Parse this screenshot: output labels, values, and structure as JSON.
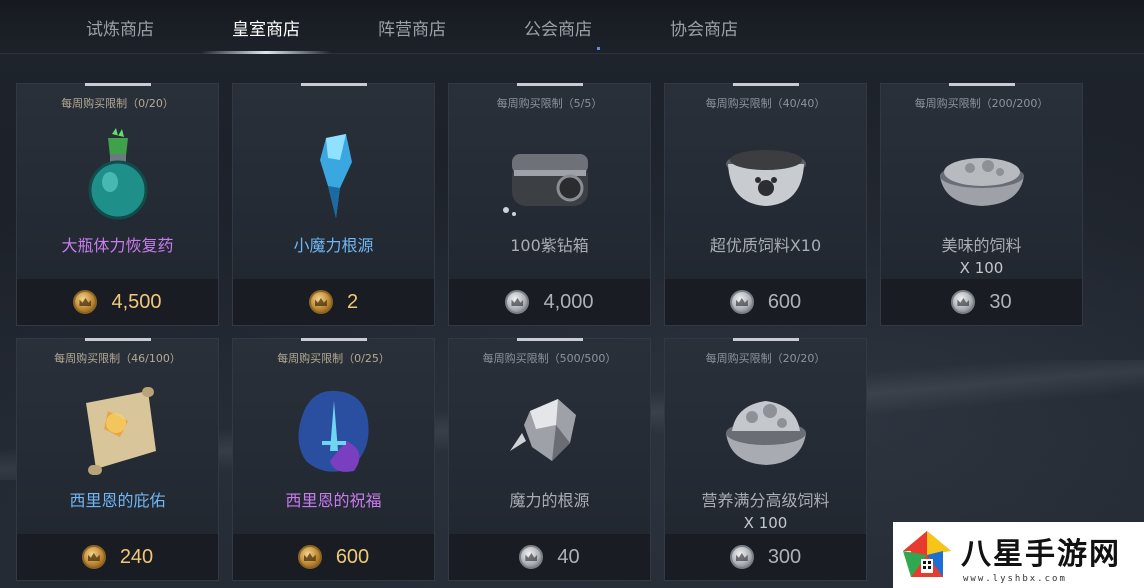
{
  "tabs": [
    {
      "label": "试炼商店",
      "active": false
    },
    {
      "label": "皇室商店",
      "active": true
    },
    {
      "label": "阵营商店",
      "active": false
    },
    {
      "label": "公会商店",
      "active": false
    },
    {
      "label": "协会商店",
      "active": false
    }
  ],
  "items": [
    {
      "limit": "每周购买限制（0/20）",
      "name": "大瓶体力恢复药",
      "qty": "",
      "price": "4,500",
      "currency": "gold",
      "name_color": "#c97cf0",
      "icon": "potion-icon"
    },
    {
      "limit": "",
      "name": "小魔力根源",
      "qty": "",
      "price": "2",
      "currency": "gold",
      "name_color": "#6fb7f5",
      "icon": "crystal-icon"
    },
    {
      "limit": "每周购买限制（5/5）",
      "name": "100紫钻箱",
      "qty": "",
      "price": "4,000",
      "currency": "silver",
      "name_color": "#a9adb3",
      "icon": "chest-icon"
    },
    {
      "limit": "每周购买限制（40/40）",
      "name": "超优质饲料X10",
      "qty": "",
      "price": "600",
      "currency": "silver",
      "name_color": "#a9adb3",
      "icon": "pet-bowl-icon"
    },
    {
      "limit": "每周购买限制（200/200）",
      "name": "美味的饲料",
      "qty": "X 100",
      "price": "30",
      "currency": "silver",
      "name_color": "#a9adb3",
      "icon": "food-bowl-icon"
    },
    {
      "limit": "每周购买限制（46/100）",
      "name": "西里恩的庇佑",
      "qty": "",
      "price": "240",
      "currency": "gold",
      "name_color": "#6fb7f5",
      "icon": "scroll-icon"
    },
    {
      "limit": "每周购买限制（0/25）",
      "name": "西里恩的祝福",
      "qty": "",
      "price": "600",
      "currency": "gold",
      "name_color": "#c97cf0",
      "icon": "rune-stone-icon"
    },
    {
      "limit": "每周购买限制（500/500）",
      "name": "魔力的根源",
      "qty": "",
      "price": "40",
      "currency": "silver",
      "name_color": "#a9adb3",
      "icon": "mana-crystal-icon"
    },
    {
      "limit": "每周购买限制（20/20）",
      "name": "营养满分高级饲料",
      "qty": "X 100",
      "price": "300",
      "currency": "silver",
      "name_color": "#a9adb3",
      "icon": "premium-food-bowl-icon"
    }
  ],
  "watermark": {
    "title": "八星手游网",
    "url": "www.lyshbx.com"
  }
}
